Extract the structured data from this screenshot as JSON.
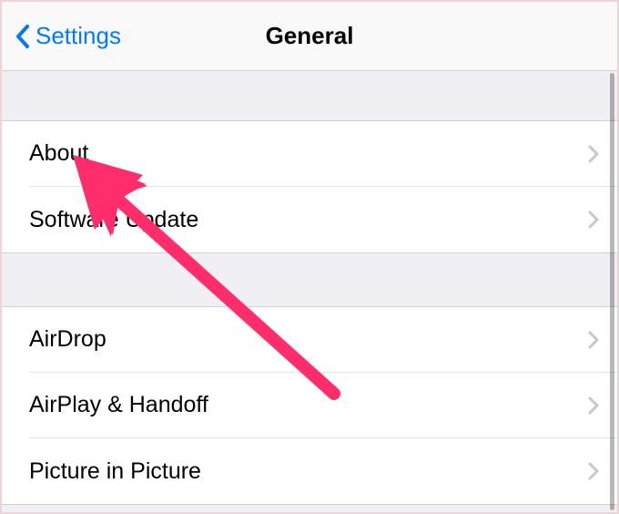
{
  "navbar": {
    "back_label": "Settings",
    "title": "General"
  },
  "groups": [
    {
      "items": [
        {
          "label": "About"
        },
        {
          "label": "Software Update"
        }
      ]
    },
    {
      "items": [
        {
          "label": "AirDrop"
        },
        {
          "label": "AirPlay & Handoff"
        },
        {
          "label": "Picture in Picture"
        }
      ]
    }
  ],
  "colors": {
    "accent": "#007aff",
    "annotation": "#ff2d6b",
    "background": "#efeff4",
    "row_background": "#ffffff",
    "separator": "#d1d1d4"
  }
}
